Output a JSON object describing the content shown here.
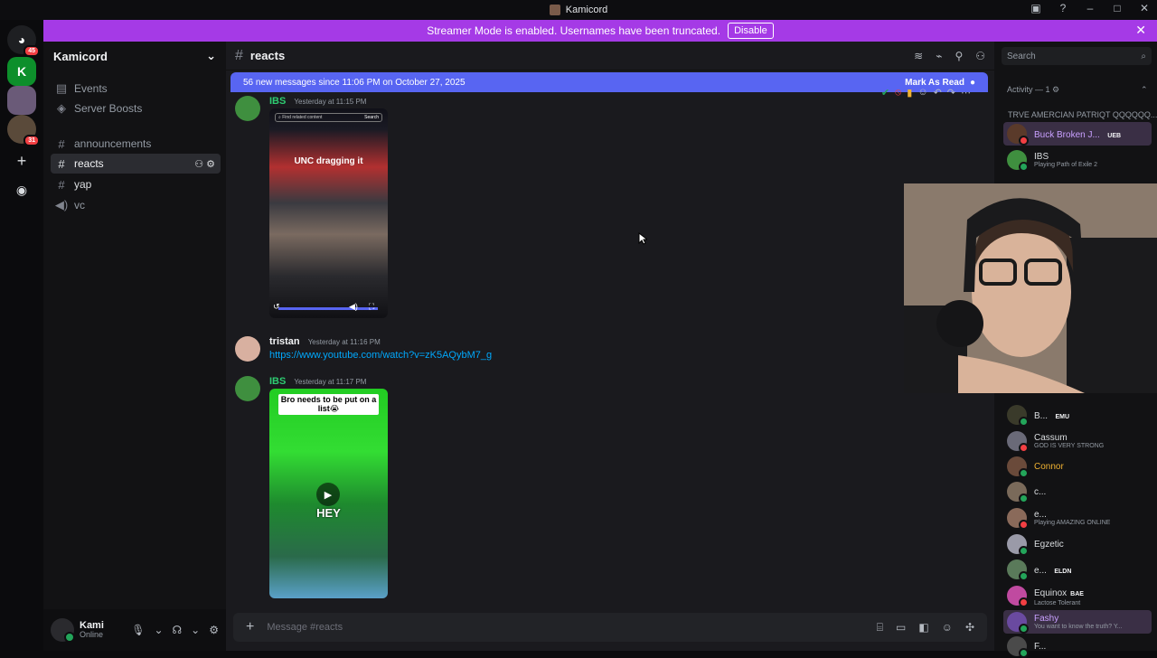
{
  "window": {
    "title": "Kamicord"
  },
  "banner": {
    "text": "Streamer Mode is enabled. Usernames have been truncated.",
    "disable_label": "Disable"
  },
  "servers": [
    {
      "badge": "45"
    },
    {
      "badge": ""
    },
    {
      "badge": ""
    },
    {
      "badge": "31"
    }
  ],
  "guild": {
    "name": "Kamicord",
    "items": [
      {
        "icon": "calendar-icon",
        "label": "Events"
      },
      {
        "icon": "boost-icon",
        "label": "Server Boosts"
      }
    ],
    "channels": [
      {
        "type": "text",
        "label": "announcements"
      },
      {
        "type": "text",
        "label": "reacts",
        "active": true
      },
      {
        "type": "text",
        "label": "yap"
      },
      {
        "type": "voice",
        "label": "vc"
      }
    ]
  },
  "user": {
    "name": "Kami",
    "status": "Online"
  },
  "channel": {
    "name": "reacts"
  },
  "new_messages": {
    "text": "56 new messages since 11:06 PM on October 27, 2025",
    "mark_read": "Mark As Read"
  },
  "messages": [
    {
      "author": "IBS",
      "time": "Yesterday at 11:15 PM",
      "media_caption": "UNC dragging it",
      "media_search": "Find related content",
      "media_search_btn": "Search"
    },
    {
      "author": "tristan",
      "time": "Yesterday at 11:16 PM",
      "link": "https://www.youtube.com/watch?v=zK5AQybM7_g"
    },
    {
      "author": "IBS",
      "time": "Yesterday at 11:17 PM",
      "media_caption": "Bro needs to be put on a list😭",
      "media_overlay": "HEY"
    }
  ],
  "composer": {
    "placeholder": "Message #reacts"
  },
  "members": {
    "search_placeholder": "Search",
    "activity_header": "Activity — 1",
    "truncated_name": "TRVE AMERCIAN PATRIQT QQQQQQ...",
    "list": [
      {
        "name": "Buck Broken J...",
        "tag": "UEB",
        "status": "",
        "color": "#c9a0ff",
        "avatar": "#5a3a2a"
      },
      {
        "name": "IBS",
        "tag": "",
        "status": "Playing Path of Exile 2",
        "color": "#dbdee1",
        "avatar": "#3f8f3f"
      },
      {
        "name": "B...",
        "tag": "EMU",
        "status": "",
        "color": "#dbdee1",
        "avatar": "#3a3a2a"
      },
      {
        "name": "Cassum",
        "tag": "",
        "status": "GOD IS VERY STRONG",
        "color": "#dbdee1",
        "avatar": "#6a6a78"
      },
      {
        "name": "Connor",
        "tag": "",
        "status": "",
        "color": "#f0b232",
        "avatar": "#6a4a3a"
      },
      {
        "name": "c...",
        "tag": "",
        "status": "",
        "color": "#dbdee1",
        "avatar": "#7a6a5a"
      },
      {
        "name": "e...",
        "tag": "",
        "status": "Playing AMAZING ONLINE",
        "color": "#dbdee1",
        "avatar": "#8a6a5a"
      },
      {
        "name": "Egzetic",
        "tag": "",
        "status": "",
        "color": "#dbdee1",
        "avatar": "#9a9aa8"
      },
      {
        "name": "e...",
        "tag": "ELDN",
        "status": "",
        "color": "#dbdee1",
        "avatar": "#5a7a5a"
      },
      {
        "name": "Equinox",
        "tag": "BAE",
        "status": "Lactose Tolerant",
        "color": "#dbdee1",
        "avatar": "#c04aa0"
      },
      {
        "name": "Fashy",
        "tag": "",
        "status": "You want to know the truth? Y...",
        "color": "#c9a0ff",
        "avatar": "#6a4aa0"
      },
      {
        "name": "F...",
        "tag": "",
        "status": "",
        "color": "#dbdee1",
        "avatar": "#4a4a4a"
      }
    ]
  },
  "colors": {
    "accent": "#5865f2",
    "banner": "#a53ae6",
    "online": "#23a55a",
    "link": "#00a8fc"
  }
}
